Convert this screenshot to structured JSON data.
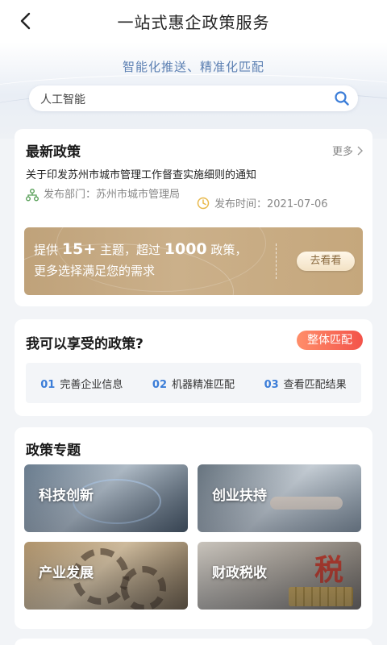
{
  "header": {
    "title": "一站式惠企政策服务",
    "back_icon": "chevron-left-icon"
  },
  "hero": {
    "slogan": "智能化推送、精准化匹配",
    "search": {
      "value": "人工智能",
      "icon": "search-icon"
    }
  },
  "latest": {
    "title": "最新政策",
    "more_label": "更多",
    "notice_title": "关于印发苏州市城市管理工作督查实施细则的通知",
    "dept_label": "发布部门：苏州市城市管理局",
    "time_label": "发布时间：2021-07-06",
    "banner": {
      "prefix": "提供",
      "topics_count": "15+",
      "middle": "主题，超过",
      "policy_count": "1000",
      "suffix": "政策，更多选择满足您的需求",
      "button_label": "去看看"
    }
  },
  "eligible": {
    "title": "我可以享受的政策?",
    "match_button": "整体匹配",
    "steps": [
      {
        "num": "01",
        "label": "完善企业信息"
      },
      {
        "num": "02",
        "label": "机器精准匹配"
      },
      {
        "num": "03",
        "label": "查看匹配结果"
      }
    ]
  },
  "topics": {
    "title": "政策专题",
    "items": [
      {
        "label": "科技创新"
      },
      {
        "label": "创业扶持"
      },
      {
        "label": "产业发展"
      },
      {
        "label": "财政税收",
        "image_text": "税"
      }
    ]
  },
  "colors": {
    "accent_blue": "#3b7dd8",
    "match_red": "#f3534a",
    "banner_gold": "#c5a77c"
  }
}
